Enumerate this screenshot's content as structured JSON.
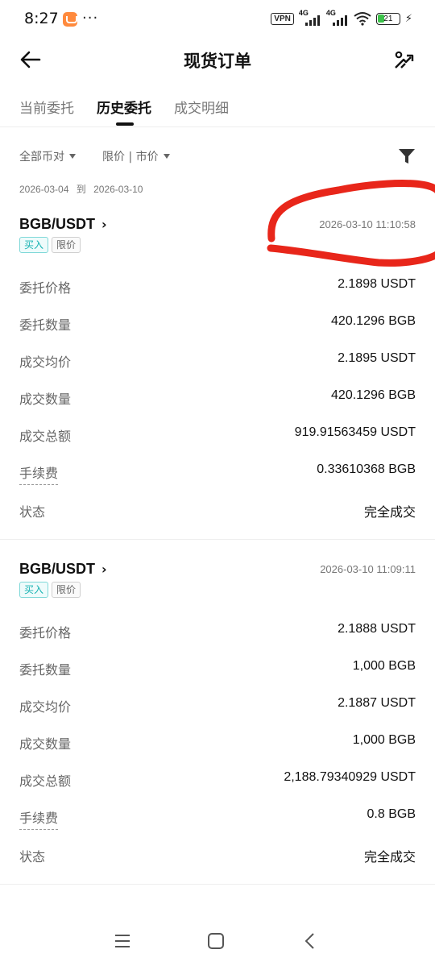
{
  "status_bar": {
    "time": "8:27",
    "dots": "···",
    "vpn": "VPN",
    "net1": "4G",
    "net2": "4G",
    "battery": "21"
  },
  "header": {
    "title": "现货订单"
  },
  "tabs": [
    {
      "label": "当前委托",
      "active": false
    },
    {
      "label": "历史委托",
      "active": true
    },
    {
      "label": "成交明细",
      "active": false
    }
  ],
  "filters": {
    "pairs": "全部币对",
    "order_type": "限价 | 市价"
  },
  "date_range": {
    "start": "2026-03-04",
    "sep": "到",
    "end": "2026-03-10"
  },
  "orders": [
    {
      "pair": "BGB/USDT",
      "time": "2026-03-10 11:10:58",
      "side": "买入",
      "type": "限价",
      "rows": [
        {
          "label": "委托价格",
          "value": "2.1898 USDT"
        },
        {
          "label": "委托数量",
          "value": "420.1296 BGB"
        },
        {
          "label": "成交均价",
          "value": "2.1895 USDT"
        },
        {
          "label": "成交数量",
          "value": "420.1296 BGB"
        },
        {
          "label": "成交总额",
          "value": "919.91563459 USDT"
        },
        {
          "label": "手续费",
          "value": "0.33610368 BGB"
        },
        {
          "label": "状态",
          "value": "完全成交"
        }
      ]
    },
    {
      "pair": "BGB/USDT",
      "time": "2026-03-10 11:09:11",
      "side": "买入",
      "type": "限价",
      "rows": [
        {
          "label": "委托价格",
          "value": "2.1888 USDT"
        },
        {
          "label": "委托数量",
          "value": "1,000 BGB"
        },
        {
          "label": "成交均价",
          "value": "2.1887 USDT"
        },
        {
          "label": "成交数量",
          "value": "1,000 BGB"
        },
        {
          "label": "成交总额",
          "value": "2,188.79340929 USDT"
        },
        {
          "label": "手续费",
          "value": "0.8 BGB"
        },
        {
          "label": "状态",
          "value": "完全成交"
        }
      ]
    }
  ],
  "colors": {
    "buy_tag": "#17b3b3",
    "annotation": "#e8261a"
  }
}
